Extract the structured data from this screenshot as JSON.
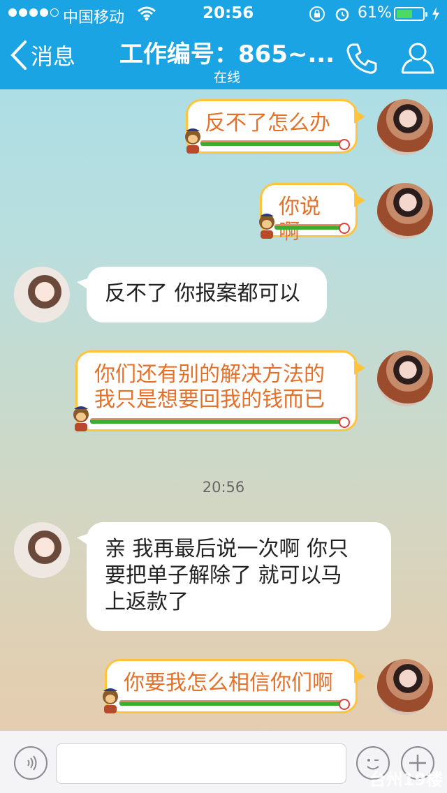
{
  "status_bar": {
    "carrier": "中国移动",
    "time": "20:56",
    "battery_percent": "61%",
    "battery_level": 0.61
  },
  "nav": {
    "back_label": "消息",
    "title": "工作编号：865~...",
    "subtitle": "在线",
    "icons": {
      "back": "chevron-left-icon",
      "phone": "phone-icon",
      "profile": "person-icon"
    }
  },
  "messages": [
    {
      "from": "me",
      "text": "反不了怎么办"
    },
    {
      "from": "me",
      "text": "你说啊"
    },
    {
      "from": "other",
      "text": "反不了 你报案都可以"
    },
    {
      "from": "me",
      "lines": [
        "你们还有别的解决方法的",
        "我只是想要回我的钱而已"
      ]
    },
    {
      "timestamp": "20:56"
    },
    {
      "from": "other",
      "lines": [
        "亲 我再最后说一次啊 你只",
        "要把单子解除了 就可以马",
        "上返款了"
      ]
    },
    {
      "from": "me",
      "text": "你要我怎么相信你们啊"
    }
  ],
  "input_bar": {
    "placeholder": "",
    "icons": {
      "voice": "voice-icon",
      "emoji": "emoji-icon",
      "plus": "plus-icon"
    }
  },
  "watermark": "台州19楼",
  "colors": {
    "nav": "#1ba4e4",
    "bubble_border": "#ffc43b",
    "bubble_text": "#e4712a"
  }
}
